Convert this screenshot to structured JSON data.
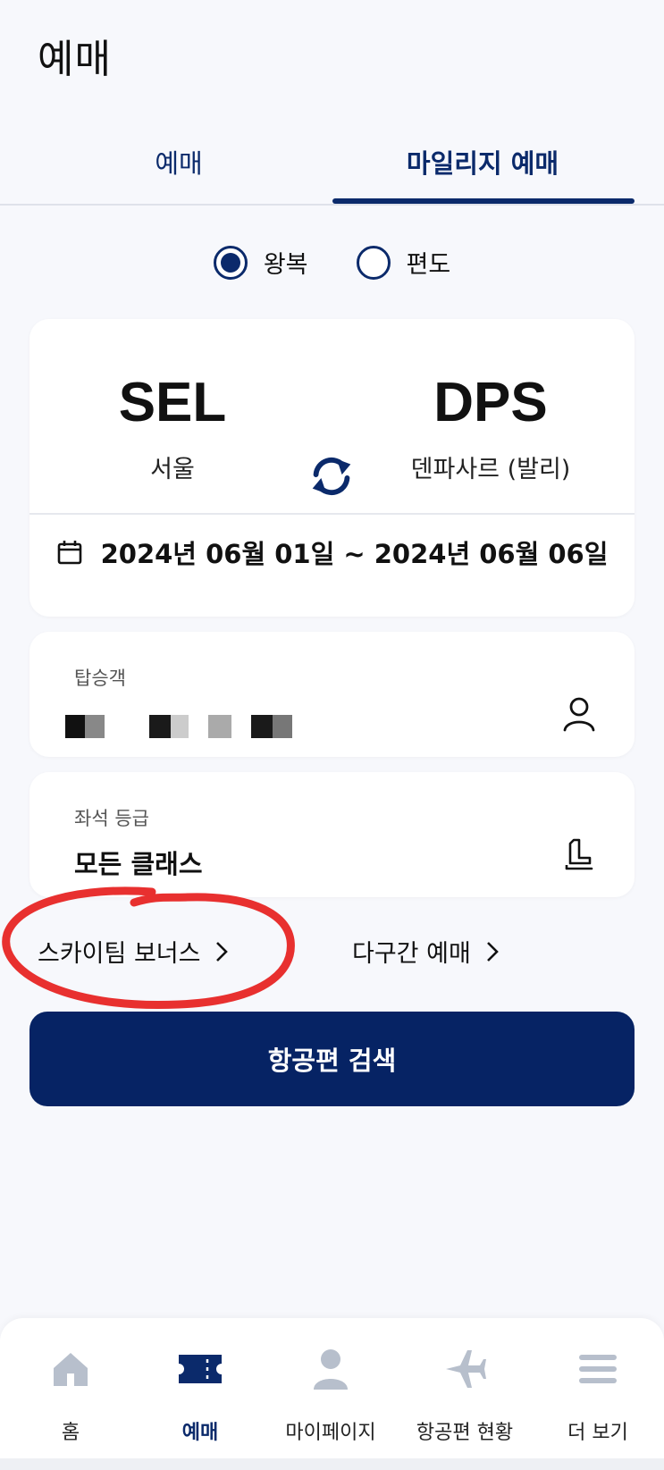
{
  "header": {
    "title": "예매"
  },
  "tabs": [
    {
      "label": "예매"
    },
    {
      "label": "마일리지 예매",
      "active": true
    }
  ],
  "trip_type": {
    "options": [
      {
        "label": "왕복",
        "selected": true
      },
      {
        "label": "편도",
        "selected": false
      }
    ]
  },
  "route": {
    "origin": {
      "code": "SEL",
      "name": "서울"
    },
    "destination": {
      "code": "DPS",
      "name": "덴파사르 (발리)"
    },
    "dates": "2024년 06월 01일 ~ 2024년 06월 06일",
    "icons": {
      "swap": "swap-arrows-icon",
      "date": "calendar-icon"
    }
  },
  "passengers": {
    "label": "탑승객",
    "icon": "person-icon"
  },
  "seat_class": {
    "label": "좌석 등급",
    "value": "모든 클래스",
    "icon": "seat-icon"
  },
  "links": [
    {
      "label": "스카이팀 보너스"
    },
    {
      "label": "다구간 예매"
    }
  ],
  "search_button": {
    "label": "항공편 검색"
  },
  "bottom_nav": [
    {
      "label": "홈",
      "icon": "home-icon"
    },
    {
      "label": "예매",
      "icon": "ticket-icon",
      "active": true
    },
    {
      "label": "마이페이지",
      "icon": "person-icon"
    },
    {
      "label": "항공편 현황",
      "icon": "airplane-icon"
    },
    {
      "label": "더 보기",
      "icon": "menu-icon"
    }
  ],
  "colors": {
    "primary": "#062364",
    "accent_tab": "#0b2a6b",
    "annotation": "#e8302f",
    "inactive_icon": "#b7bfcc"
  }
}
